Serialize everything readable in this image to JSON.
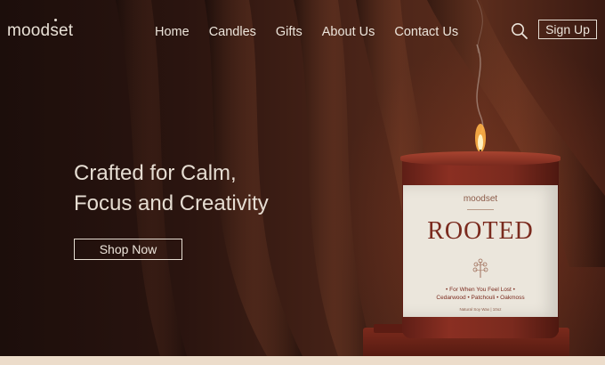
{
  "brand": {
    "logo_text": "moodset"
  },
  "nav": {
    "items": [
      {
        "label": "Home"
      },
      {
        "label": "Candles"
      },
      {
        "label": "Gifts"
      },
      {
        "label": "About Us"
      },
      {
        "label": "Contact Us"
      }
    ]
  },
  "header": {
    "search_icon": "search-icon",
    "signup_label": "Sign Up"
  },
  "hero": {
    "headline_line1": "Crafted for Calm,",
    "headline_line2": "Focus and Creativity",
    "cta_label": "Shop Now"
  },
  "product": {
    "label_brand": "moodset",
    "label_title": "ROOTED",
    "tagline": "• For When You Feel Lost •",
    "notes": "Cedarwood • Patchouli • Oakmoss",
    "fine_print": "Natural Soy Wax  |  10oz"
  },
  "colors": {
    "background_dark": "#2a140f",
    "text_light": "#ece4da",
    "candle_red": "#7a2a1e",
    "label_cream": "#ebe6dc",
    "footer_strip": "#ecdcca"
  }
}
